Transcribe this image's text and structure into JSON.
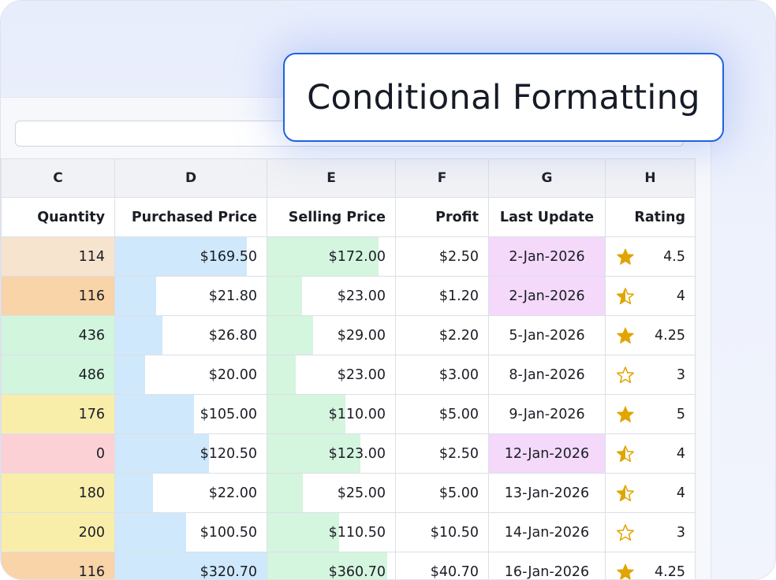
{
  "banner": {
    "title": "Conditional Formatting"
  },
  "columns": [
    "C",
    "D",
    "E",
    "F",
    "G",
    "H"
  ],
  "fields": [
    "Quantity",
    "Purchased Price",
    "Selling Price",
    "Profit",
    "Last Update",
    "Rating"
  ],
  "colors": {
    "accent": "#1f63e0",
    "bar_blue": "#cfe8fb",
    "bar_green": "#d4f5de",
    "date_highlight": "#f4d9fb",
    "star": "#e0a500",
    "quantity_scale": {
      "peach_light": "#f7e4cf",
      "peach": "#f8d4a8",
      "green": "#d1f5dd",
      "yellow": "#f8eeaa",
      "red": "#fbd1d5"
    }
  },
  "rows": [
    {
      "quantity": "114",
      "quantity_color": "#f7e4cf",
      "purchased": "$169.50",
      "purchased_bar": 0.87,
      "selling": "$172.00",
      "selling_bar": 0.87,
      "profit": "$2.50",
      "last_update": "2-Jan-2026",
      "date_highlight": true,
      "star": "full",
      "rating": "4.5"
    },
    {
      "quantity": "116",
      "quantity_color": "#f8d4a8",
      "purchased": "$21.80",
      "purchased_bar": 0.27,
      "selling": "$23.00",
      "selling_bar": 0.27,
      "profit": "$1.20",
      "last_update": "2-Jan-2026",
      "date_highlight": true,
      "star": "half",
      "rating": "4"
    },
    {
      "quantity": "436",
      "quantity_color": "#d1f5dd",
      "purchased": "$26.80",
      "purchased_bar": 0.31,
      "selling": "$29.00",
      "selling_bar": 0.36,
      "profit": "$2.20",
      "last_update": "5-Jan-2026",
      "date_highlight": false,
      "star": "full",
      "rating": "4.25"
    },
    {
      "quantity": "486",
      "quantity_color": "#d1f5dd",
      "purchased": "$20.00",
      "purchased_bar": 0.2,
      "selling": "$23.00",
      "selling_bar": 0.22,
      "profit": "$3.00",
      "last_update": "8-Jan-2026",
      "date_highlight": false,
      "star": "empty",
      "rating": "3"
    },
    {
      "quantity": "176",
      "quantity_color": "#f8eeaa",
      "purchased": "$105.00",
      "purchased_bar": 0.52,
      "selling": "$110.00",
      "selling_bar": 0.61,
      "profit": "$5.00",
      "last_update": "9-Jan-2026",
      "date_highlight": false,
      "star": "full",
      "rating": "5"
    },
    {
      "quantity": "0",
      "quantity_color": "#fbd1d5",
      "purchased": "$120.50",
      "purchased_bar": 0.62,
      "selling": "$123.00",
      "selling_bar": 0.73,
      "profit": "$2.50",
      "last_update": "12-Jan-2026",
      "date_highlight": true,
      "star": "half",
      "rating": "4"
    },
    {
      "quantity": "180",
      "quantity_color": "#f8eeaa",
      "purchased": "$22.00",
      "purchased_bar": 0.25,
      "selling": "$25.00",
      "selling_bar": 0.28,
      "profit": "$5.00",
      "last_update": "13-Jan-2026",
      "date_highlight": false,
      "star": "half",
      "rating": "4"
    },
    {
      "quantity": "200",
      "quantity_color": "#f8eeaa",
      "purchased": "$100.50",
      "purchased_bar": 0.47,
      "selling": "$110.50",
      "selling_bar": 0.56,
      "profit": "$10.50",
      "last_update": "14-Jan-2026",
      "date_highlight": false,
      "star": "empty",
      "rating": "3"
    },
    {
      "quantity": "116",
      "quantity_color": "#f8d4a8",
      "purchased": "$320.70",
      "purchased_bar": 1.0,
      "selling": "$360.70",
      "selling_bar": 0.94,
      "profit": "$40.70",
      "last_update": "16-Jan-2026",
      "date_highlight": false,
      "star": "full",
      "rating": "4.25"
    }
  ]
}
